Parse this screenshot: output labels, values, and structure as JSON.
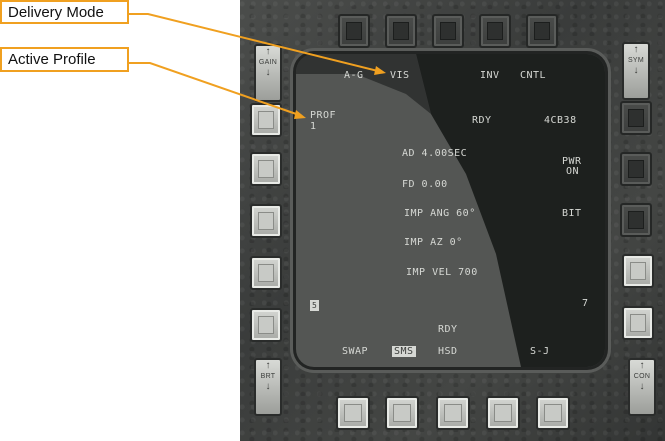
{
  "callouts": {
    "delivery_mode": "Delivery Mode",
    "active_profile": "Active Profile"
  },
  "colors": {
    "callout_border": "#f0a020",
    "display_text": "#d6d8d4"
  },
  "rockers": {
    "gain": {
      "label": "GAIN",
      "up": "↑",
      "down": "↓"
    },
    "sym": {
      "label": "SYM",
      "up": "↑",
      "down": "↓"
    },
    "brt": {
      "label": "BRT",
      "up": "↑",
      "down": "↓"
    },
    "con": {
      "label": "CON",
      "up": "↑",
      "down": "↓"
    }
  },
  "display": {
    "top": {
      "ag": "A-G",
      "vis": "VIS",
      "inv": "INV",
      "cntl": "CNTL"
    },
    "left": {
      "prof": "PROF",
      "prof_num": "1"
    },
    "right": {
      "id": "4CB38",
      "pwr": "PWR",
      "pwr_state": "ON",
      "bit": "BIT"
    },
    "status_top": "RDY",
    "params": {
      "ad": "AD 4.00SEC",
      "fd": "FD 0.00",
      "imp_ang": "IMP ANG 60°",
      "imp_az": "IMP AZ 0°",
      "imp_vel": "IMP VEL 700"
    },
    "station_left": "5",
    "station_right": "7",
    "status_bottom": "RDY",
    "bottom": {
      "swap": "SWAP",
      "sms": "SMS",
      "hsd": "HSD",
      "sj": "S-J"
    }
  }
}
